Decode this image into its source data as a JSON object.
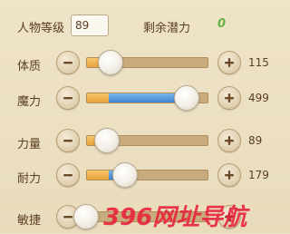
{
  "header": {
    "level_label": "人物等级",
    "level_value": "89",
    "potential_label": "剩余潜力",
    "potential_value": "0"
  },
  "stats": [
    {
      "label": "体质",
      "value": "115",
      "orange_fraction": 0.18,
      "blue_fraction": 0.0,
      "thumb_fraction": 0.2
    },
    {
      "label": "魔力",
      "value": "499",
      "orange_fraction": 0.18,
      "blue_fraction": 0.62,
      "thumb_fraction": 0.82
    },
    {
      "label": "力量",
      "value": "89",
      "orange_fraction": 0.15,
      "blue_fraction": 0.0,
      "thumb_fraction": 0.17
    },
    {
      "label": "耐力",
      "value": "179",
      "orange_fraction": 0.18,
      "blue_fraction": 0.12,
      "thumb_fraction": 0.32
    },
    {
      "label": "敏捷",
      "value": "",
      "orange_fraction": 0.0,
      "blue_fraction": 0.0,
      "thumb_fraction": 0.0
    }
  ],
  "watermark": {
    "text": "396网址导航",
    "color": "#e8243c"
  },
  "colors": {
    "accent_green": "#5fb544",
    "orange_bar": "#e8a23c",
    "blue_bar": "#3f85cf"
  }
}
